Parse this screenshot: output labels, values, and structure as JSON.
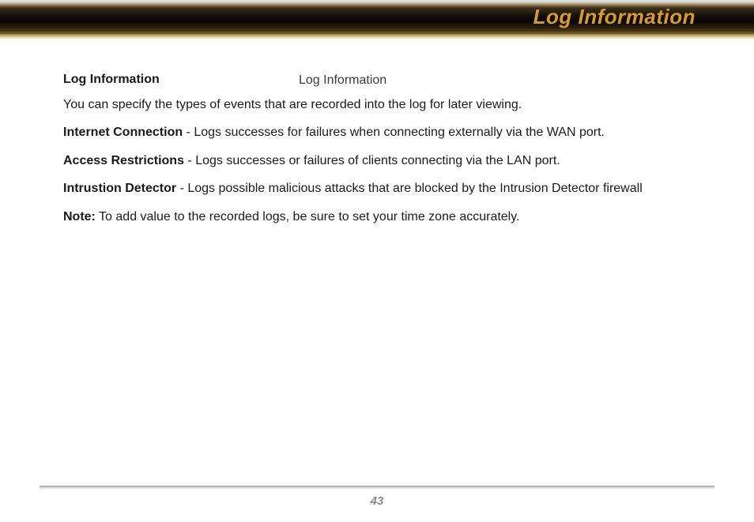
{
  "header": {
    "title": "Log Information"
  },
  "content": {
    "float_label": "Log Information",
    "section_title": "Log Information",
    "intro": "You can specify the types of events that are recorded into the log for later viewing.",
    "items": [
      {
        "label": "Internet Connection",
        "body": " - Logs successes for failures when connecting externally via the WAN port."
      },
      {
        "label": "Access Restrictions",
        "body": " - Logs successes or failures of clients connecting via the LAN port."
      },
      {
        "label": "Intrustion Detector",
        "body": " - Logs possible malicious attacks that are blocked by the Intrusion Detector firewall"
      }
    ],
    "note_label": "Note:",
    "note_body": " To add value to the recorded logs, be sure to set your time zone accurately."
  },
  "footer": {
    "page_number": "43"
  }
}
